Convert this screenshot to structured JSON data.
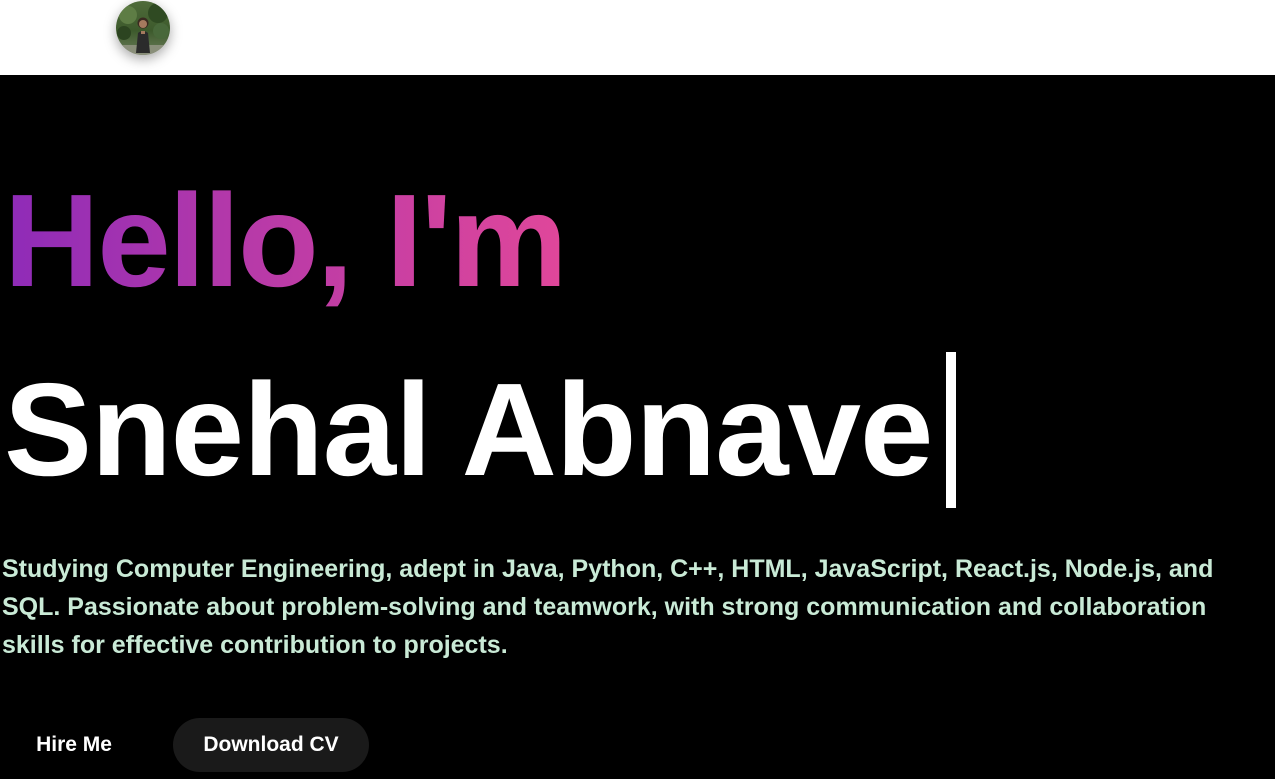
{
  "header": {
    "avatar_alt": "profile photo"
  },
  "hero": {
    "greeting": "Hello, I'm",
    "name": "Snehal Abnave",
    "bio": "Studying Computer Engineering, adept in Java, Python, C++, HTML, JavaScript, React.js, Node.js, and SQL. Passionate about problem-solving and teamwork, with strong communication and collaboration skills for effective contribution to projects.",
    "buttons": {
      "hire_label": "Hire Me",
      "cv_label": "Download CV"
    }
  },
  "colors": {
    "background": "#000000",
    "header_background": "#ffffff",
    "greeting_gradient_start": "#8e2bb8",
    "greeting_gradient_end": "#e0479a",
    "name_color": "#ffffff",
    "bio_color": "#c9ead6",
    "cv_button_bg": "#1a1a1a"
  },
  "icons": {
    "avatar": "profile-avatar-photo"
  }
}
